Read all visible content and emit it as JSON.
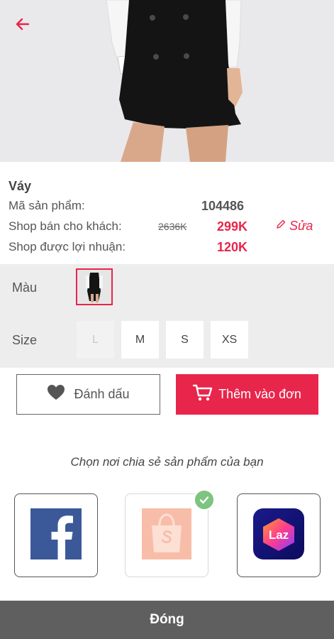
{
  "product": {
    "name": "Váy",
    "code_label": "Mã sản phẩm:",
    "code_value": "104486",
    "price_label": "Shop bán cho khách:",
    "original_price": "2636K",
    "sale_price": "299K",
    "edit_label": "Sửa",
    "profit_label": "Shop được lợi nhuận:",
    "profit_value": "120K"
  },
  "variants": {
    "color_label": "Màu",
    "size_label": "Size",
    "sizes": [
      {
        "label": "L",
        "enabled": false
      },
      {
        "label": "M",
        "enabled": true
      },
      {
        "label": "S",
        "enabled": true
      },
      {
        "label": "XS",
        "enabled": true
      }
    ]
  },
  "actions": {
    "mark_label": "Đánh dấu",
    "add_label": "Thêm vào đơn"
  },
  "share": {
    "title": "Chọn nơi chia sẻ sản phẩm của bạn",
    "platforms": [
      {
        "name": "facebook",
        "selected": false
      },
      {
        "name": "shopee",
        "selected": true
      },
      {
        "name": "lazada",
        "selected": false
      }
    ],
    "lazada_logo_text": "Laz"
  },
  "footer": {
    "close_label": "Đóng"
  },
  "colors": {
    "accent": "#e8254b",
    "facebook": "#3b5998",
    "shopee": "#f8bda8",
    "check": "#7cc47f",
    "footer": "#5f5f5f"
  },
  "icons": {
    "back": "arrow-left-icon",
    "edit": "pencil-icon",
    "mark": "heart-icon",
    "add": "cart-icon",
    "check": "check-icon"
  }
}
